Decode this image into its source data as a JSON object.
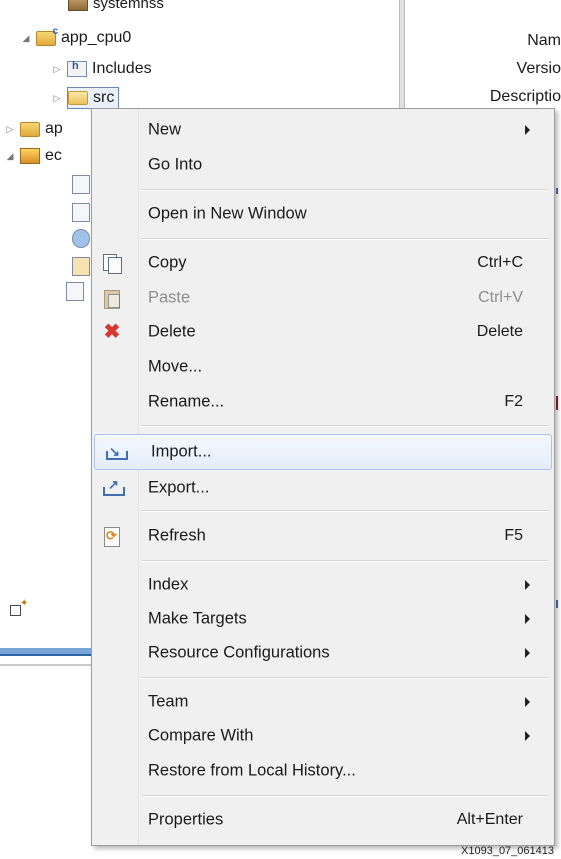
{
  "tree": {
    "items": [
      {
        "label": "systemhss"
      },
      {
        "label": "app_cpu0"
      },
      {
        "label": "Includes"
      },
      {
        "label": "src"
      },
      {
        "label": "ap"
      },
      {
        "label": "ec"
      }
    ]
  },
  "properties": {
    "labels": [
      "Nam",
      "Versio",
      "Descriptio"
    ]
  },
  "menu": {
    "new": {
      "label": "New"
    },
    "go_into": {
      "label": "Go Into"
    },
    "open_new_window": {
      "label": "Open in New Window"
    },
    "copy": {
      "label": "Copy",
      "shortcut": "Ctrl+C"
    },
    "paste": {
      "label": "Paste",
      "shortcut": "Ctrl+V"
    },
    "delete": {
      "label": "Delete",
      "shortcut": "Delete"
    },
    "move": {
      "label": "Move..."
    },
    "rename": {
      "label": "Rename...",
      "shortcut": "F2"
    },
    "import": {
      "label": "Import..."
    },
    "export": {
      "label": "Export..."
    },
    "refresh": {
      "label": "Refresh",
      "shortcut": "F5"
    },
    "index": {
      "label": "Index"
    },
    "make_targets": {
      "label": "Make Targets"
    },
    "resource_configurations": {
      "label": "Resource Configurations"
    },
    "team": {
      "label": "Team"
    },
    "compare_with": {
      "label": "Compare With"
    },
    "restore_local_history": {
      "label": "Restore from Local History..."
    },
    "properties": {
      "label": "Properties",
      "shortcut": "Alt+Enter"
    }
  },
  "caption": "X1093_07_061413",
  "colors": {
    "menu_bg": "#f0f0f0",
    "highlight": "#e3edfa",
    "delete_icon": "#d63a2f"
  }
}
